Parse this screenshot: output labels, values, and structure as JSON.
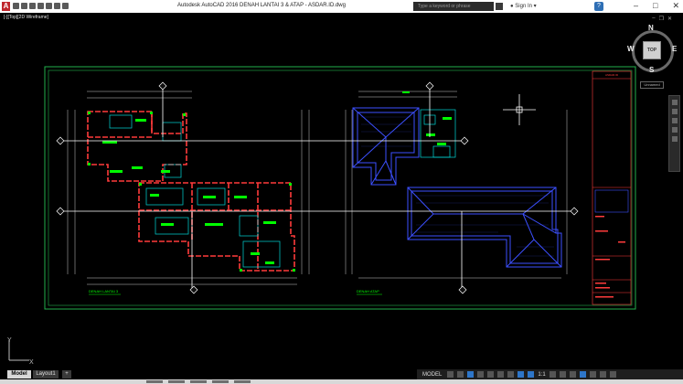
{
  "app": {
    "logo_letter": "A",
    "title": "Autodesk AutoCAD 2016      DENAH LANTAI 3 & ATAP - ASDAR.ID.dwg",
    "search_placeholder": "Type a keyword or phrase",
    "signin": "Sign In",
    "help": "?"
  },
  "viewport": {
    "label": "[-][Top][2D Wireframe]",
    "unnamed": "Unnamed"
  },
  "viewcube": {
    "north": "N",
    "south": "S",
    "east": "E",
    "west": "W",
    "face": "TOP"
  },
  "drawing": {
    "left_plan_label": "DENAH LANTAI 3",
    "right_plan_label": "DENAH ATAP",
    "title_block_header": "ASDAR.ID"
  },
  "ucs": {
    "x": "X",
    "y": "Y"
  },
  "tabs": [
    {
      "label": "Model"
    },
    {
      "label": "Layout1"
    },
    {
      "label": "+"
    }
  ],
  "status": {
    "model": "MODEL",
    "scale": "1:1"
  },
  "colors": {
    "background": "#000000",
    "sheet_border": "#22b14c",
    "walls": "#ff3b3b",
    "fixtures": "#00d8d8",
    "labels": "#00ff00",
    "roof": "#3c50ff",
    "crosshair": "#ffffff"
  }
}
